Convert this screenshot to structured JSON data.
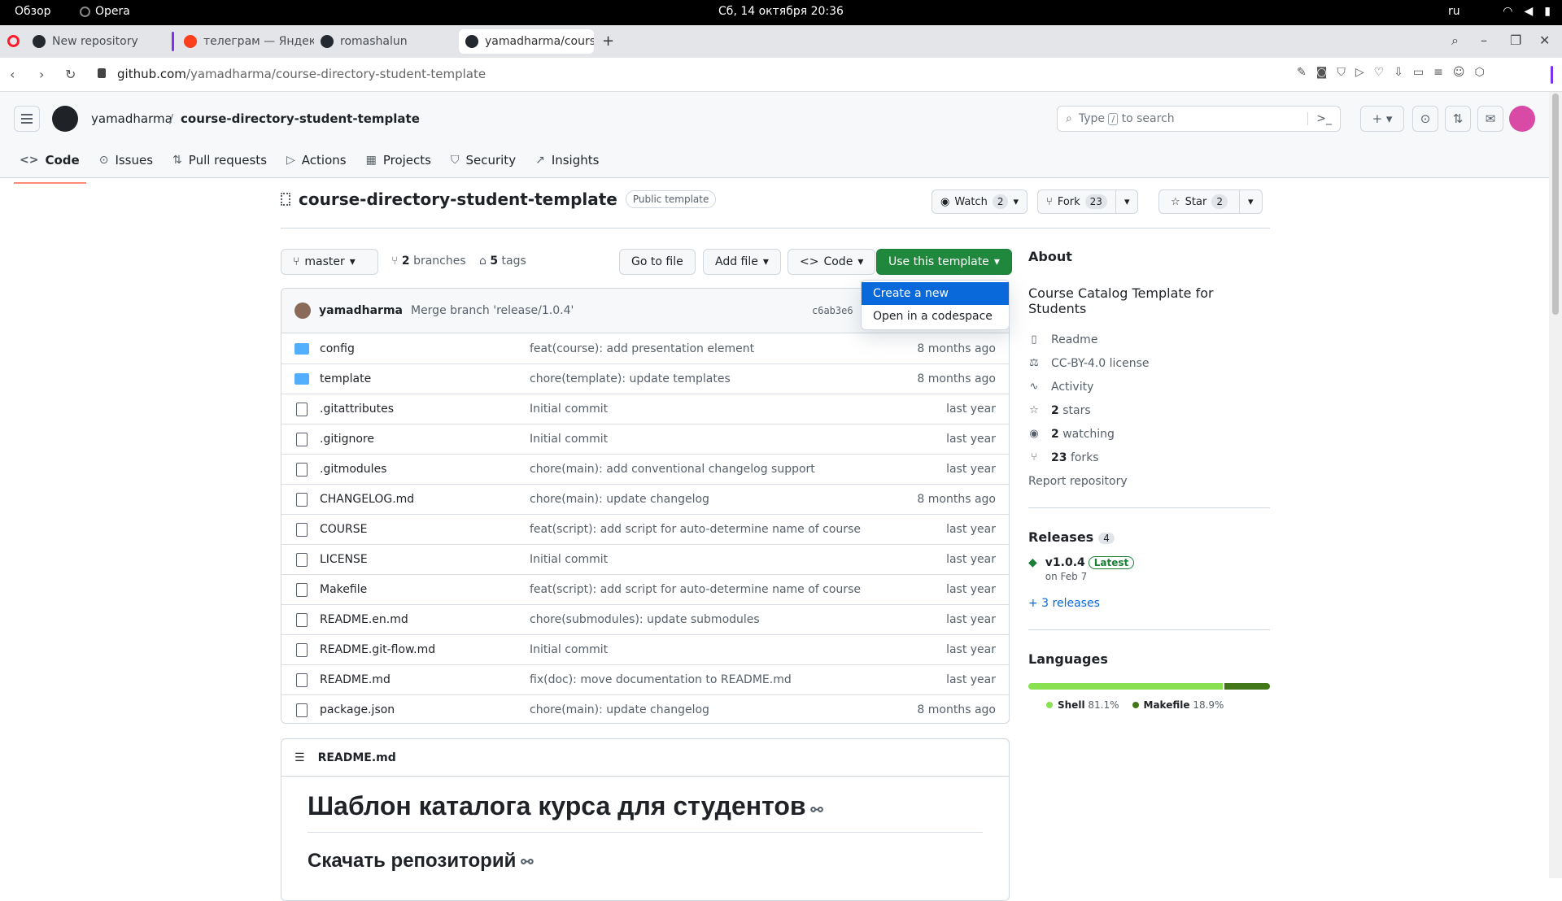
{
  "os": {
    "overview": "Обзор",
    "app": "Opera",
    "clock": "Сб, 14 октября  20:36",
    "lang": "ru"
  },
  "browser": {
    "tabs": [
      {
        "label": "New repository"
      },
      {
        "label": "телеграм — Яндекс"
      },
      {
        "label": "romashalun"
      },
      {
        "label": "yamadharma/course-"
      }
    ],
    "url_host": "github.com",
    "url_path": "/yamadharma/course-directory-student-template"
  },
  "header": {
    "owner": "yamadharma",
    "separator": "/",
    "repo": "course-directory-student-template",
    "search_pre": "Type",
    "search_key": "/",
    "search_post": "to search"
  },
  "nav": [
    {
      "label": "Code",
      "icon": "<>"
    },
    {
      "label": "Issues",
      "icon": "⊙"
    },
    {
      "label": "Pull requests",
      "icon": "⇅"
    },
    {
      "label": "Actions",
      "icon": "▷"
    },
    {
      "label": "Projects",
      "icon": "▦"
    },
    {
      "label": "Security",
      "icon": "⛉"
    },
    {
      "label": "Insights",
      "icon": "↗"
    }
  ],
  "repo": {
    "title": "course-directory-student-template",
    "visibility": "Public template",
    "watch_label": "Watch",
    "watch_count": "2",
    "fork_label": "Fork",
    "fork_count": "23",
    "star_label": "Star",
    "star_count": "2"
  },
  "toolbar": {
    "branch": "master",
    "branches_count": "2",
    "branches_label": "branches",
    "tags_count": "5",
    "tags_label": "tags",
    "goto_file": "Go to file",
    "add_file": "Add file",
    "code": "Code",
    "use_template": "Use this template"
  },
  "dropdown": {
    "items": [
      "Create a new repository",
      "Open in a codespace"
    ]
  },
  "commit": {
    "author": "yamadharma",
    "message": "Merge branch 'release/1.0.4'",
    "sha": "c6ab3e6"
  },
  "files": [
    {
      "name": "config",
      "type": "folder",
      "message": "feat(course): add presentation element",
      "age": "8 months ago"
    },
    {
      "name": "template",
      "type": "folder",
      "message": "chore(template): update templates",
      "age": "8 months ago"
    },
    {
      "name": ".gitattributes",
      "type": "file",
      "message": "Initial commit",
      "age": "last year"
    },
    {
      "name": ".gitignore",
      "type": "file",
      "message": "Initial commit",
      "age": "last year"
    },
    {
      "name": ".gitmodules",
      "type": "file",
      "message": "chore(main): add conventional changelog support",
      "age": "last year"
    },
    {
      "name": "CHANGELOG.md",
      "type": "file",
      "message": "chore(main): update changelog",
      "age": "8 months ago"
    },
    {
      "name": "COURSE",
      "type": "file",
      "message": "feat(script): add script for auto-determine name of course",
      "age": "last year"
    },
    {
      "name": "LICENSE",
      "type": "file",
      "message": "Initial commit",
      "age": "last year"
    },
    {
      "name": "Makefile",
      "type": "file",
      "message": "feat(script): add script for auto-determine name of course",
      "age": "last year"
    },
    {
      "name": "README.en.md",
      "type": "file",
      "message": "chore(submodules): update submodules",
      "age": "last year"
    },
    {
      "name": "README.git-flow.md",
      "type": "file",
      "message": "Initial commit",
      "age": "last year"
    },
    {
      "name": "README.md",
      "type": "file",
      "message": "fix(doc): move documentation to README.md",
      "age": "last year"
    },
    {
      "name": "package.json",
      "type": "file",
      "message": "chore(main): update changelog",
      "age": "8 months ago"
    }
  ],
  "readme": {
    "filename": "README.md",
    "h1": "Шаблон каталога курса для студентов",
    "h2": "Скачать репозиторий"
  },
  "about": {
    "heading": "About",
    "description": "Course Catalog Template for Students",
    "readme": "Readme",
    "license": "CC-BY-4.0 license",
    "activity": "Activity",
    "stars_count": "2",
    "stars_label": "stars",
    "watching_count": "2",
    "watching_label": "watching",
    "forks_count": "23",
    "forks_label": "forks",
    "report": "Report repository"
  },
  "releases": {
    "heading": "Releases",
    "count": "4",
    "tag": "v1.0.4",
    "latest": "Latest",
    "date": "on Feb 7",
    "more": "+ 3 releases"
  },
  "languages": {
    "heading": "Languages",
    "items": [
      {
        "name": "Shell",
        "percent": "81.1%",
        "value": 81.1,
        "color": "#89e051"
      },
      {
        "name": "Makefile",
        "percent": "18.9%",
        "value": 18.9,
        "color": "#427819"
      }
    ]
  },
  "colors": {
    "accent_blue": "#0969da",
    "primary_green": "#1f883d",
    "nav_underline": "#fd8c73"
  }
}
